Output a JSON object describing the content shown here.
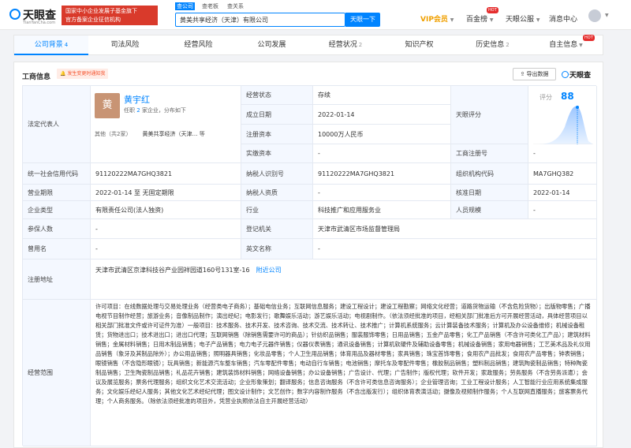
{
  "header": {
    "logo_text": "天眼查",
    "logo_sub": "TianYanCha.com",
    "banner_line1": "国家中小企业发展子基金旗下",
    "banner_line2": "官方备案企业征信机构",
    "search_tabs": [
      "查公司",
      "查老板",
      "查关系"
    ],
    "search_value": "黄美共享经济（天津）有限公司",
    "search_button": "天眼一下",
    "nav": {
      "vip": "VIP会员",
      "baibang": "百金榜",
      "baibang_badge": "HOT",
      "tyc_pro": "天眼公服",
      "messages": "消息中心"
    }
  },
  "tabs": [
    {
      "label": "公司背景",
      "count": "4"
    },
    {
      "label": "司法风险",
      "count": ""
    },
    {
      "label": "经营风险",
      "count": ""
    },
    {
      "label": "公司发展",
      "count": ""
    },
    {
      "label": "经营状况",
      "count": "2"
    },
    {
      "label": "知识产权",
      "count": ""
    },
    {
      "label": "历史信息",
      "count": "2"
    },
    {
      "label": "自主信息",
      "count": "",
      "badge": "HOT"
    }
  ],
  "section": {
    "title": "工商信息",
    "change_badge": "发生变更时通知我",
    "export_button": "导出数据",
    "brand": "天眼查"
  },
  "legal_rep": {
    "label": "法定代表人",
    "avatar_char": "黄",
    "name": "黄宇红",
    "roles_prefix": "任职",
    "roles_count": "2",
    "roles_suffix": "家企业，分布如下",
    "other": "其他（共2家）",
    "company": "黄美共享经济（天津…",
    "more": "等"
  },
  "score": {
    "label": "评分",
    "value": "88",
    "row_label": "天眼评分"
  },
  "fields": {
    "status_label": "经营状态",
    "status_value": "存续",
    "est_label": "成立日期",
    "est_value": "2022-01-14",
    "capital_label": "注册资本",
    "capital_value": "10000万人民币",
    "paid_label": "实缴资本",
    "paid_value": "-",
    "reg_no_label": "工商注册号",
    "reg_no_value": "-",
    "credit_label": "统一社会信用代码",
    "credit_value": "91120222MA7GHQ3821",
    "taxpayer_label": "纳税人识别号",
    "taxpayer_value": "91120222MA7GHQ3821",
    "org_label": "组织机构代码",
    "org_value": "MA7GHQ382",
    "term_label": "营业期限",
    "term_value": "2022-01-14 至 无固定期限",
    "taxq_label": "纳税人资质",
    "taxq_value": "-",
    "approve_label": "核准日期",
    "approve_value": "2022-01-14",
    "type_label": "企业类型",
    "type_value": "有限责任公司(法人独资)",
    "industry_label": "行业",
    "industry_value": "科技推广和应用服务业",
    "staff_label": "人员规模",
    "staff_value": "-",
    "insured_label": "参保人数",
    "insured_value": "-",
    "authority_label": "登记机关",
    "authority_value": "天津市武清区市场监督管理局",
    "former_label": "曾用名",
    "former_value": "-",
    "english_label": "英文名称",
    "english_value": "-",
    "address_label": "注册地址",
    "address_value": "天津市武清区京津科技谷产业园祥园道160号131室-16",
    "address_link": "附近公司",
    "scope_label": "经营范围",
    "scope_value": "许可项目：在线数据处理与交易处理业务（经营类电子商务）；基础电信业务；互联网信息服务；建设工程设计；建设工程勘察；网络文化经营；道路货物运输（不含危险货物）；出版物零售；广播电视节目制作经营；旅游业务；音像制品制作；演出经纪；电影发行；歌舞娱乐活动；游艺娱乐活动；电视剧制作。（依法须经批准的项目，经相关部门批准后方可开展经营活动，具体经营项目以相关部门批准文件或许可证件为准）一般项目：技术服务、技术开发、技术咨询、技术交流、技术转让、技术推广；计算机系统服务；云计算装备技术服务；计算机及办公设备维修；机械设备租赁；货物进出口；技术进出口；进出口代理；互联网销售（除销售需要许可的商品）；针纺织品销售；服装服饰零售；日用品销售；五金产品零售；化工产品销售（不含许可类化工产品）；建筑材料销售；金属材料销售；日用木制品销售；电子产品销售；电力电子元器件销售；仪器仪表销售；通讯设备销售；计算机软硬件及辅助设备零售；机械设备销售；家用电器销售；工艺美术品及礼仪用品销售（象牙及其制品除外）；办公用品销售；照明器具销售；化妆品零售；个人卫生用品销售；体育用品及器材零售；家具销售；珠宝首饰零售；食用农产品批发；食用农产品零售；钟表销售；眼镜销售（不含隐形眼镜）；玩具销售；新能源汽车整车销售；汽车零配件零售；电动自行车销售；电池销售；摩托车及零配件零售；橡胶制品销售；塑料制品销售；建筑陶瓷制品销售；特种陶瓷制品销售；卫生陶瓷制品销售；礼品花卉销售；建筑装饰材料销售；网络设备销售；办公设备销售；广告设计、代理；广告制作；版权代理；软件开发；家政服务；劳务服务（不含劳务派遣）；会议及展览服务；票务代理服务；组织文化艺术交流活动；企业形象策划；翻译服务；信息咨询服务（不含许可类信息咨询服务）；企业管理咨询；工业工程设计服务；人工智能行业应用系统集成服务；文化娱乐经纪人服务；其他文化艺术经纪代理；图文设计制作；文艺创作；数字内容制作服务（不含出版发行）；组织体育表演活动；摄像及视频制作服务；个人互联网直播服务；旅客票务代理；个人商务服务。（除依法须经批准的项目外，凭营业执照依法自主开展经营活动）"
  },
  "colors": {
    "accent": "#0084ff",
    "banner": "#d93a2b",
    "vip": "#f0a000",
    "hot": "#e52d2d"
  }
}
